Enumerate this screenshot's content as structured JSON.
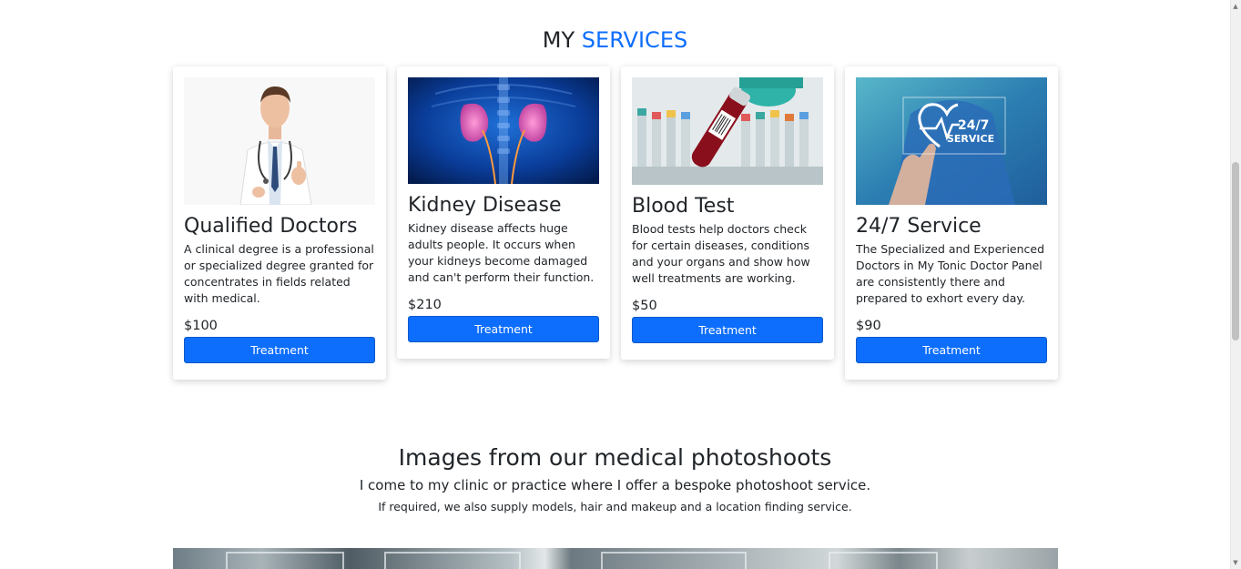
{
  "services": {
    "title_prefix": "MY",
    "title_accent": "SERVICES",
    "accent_color": "#0d6efd",
    "cards": [
      {
        "image": "doctor-thumbs-up-image",
        "title": "Qualified Doctors",
        "description": "A clinical degree is a professional or specialized degree granted for concentrates in fields related with medical.",
        "price": "$100",
        "button": "Treatment"
      },
      {
        "image": "kidney-xray-image",
        "title": "Kidney Disease",
        "description": "Kidney disease affects huge adults people. It occurs when your kidneys become damaged and can't perform their function.",
        "price": "$210",
        "button": "Treatment"
      },
      {
        "image": "blood-test-tubes-image",
        "title": "Blood Test",
        "description": "Blood tests help doctors check for certain diseases, conditions and your organs and show how well treatments are working.",
        "price": "$50",
        "button": "Treatment"
      },
      {
        "image": "24-7-service-image",
        "image_text_top": "24/7",
        "image_text_bottom": "SERVICE",
        "title": "24/7 Service",
        "description": "The Specialized and Experienced Doctors in My Tonic Doctor Panel are consistently there and prepared to exhort every day.",
        "price": "$90",
        "button": "Treatment"
      }
    ]
  },
  "photoshoots": {
    "title": "Images from our medical photoshoots",
    "subtitle": "I come to my clinic or practice where I offer a bespoke photoshoot service.",
    "note": "If required, we also supply models, hair and makeup and a location finding service."
  }
}
